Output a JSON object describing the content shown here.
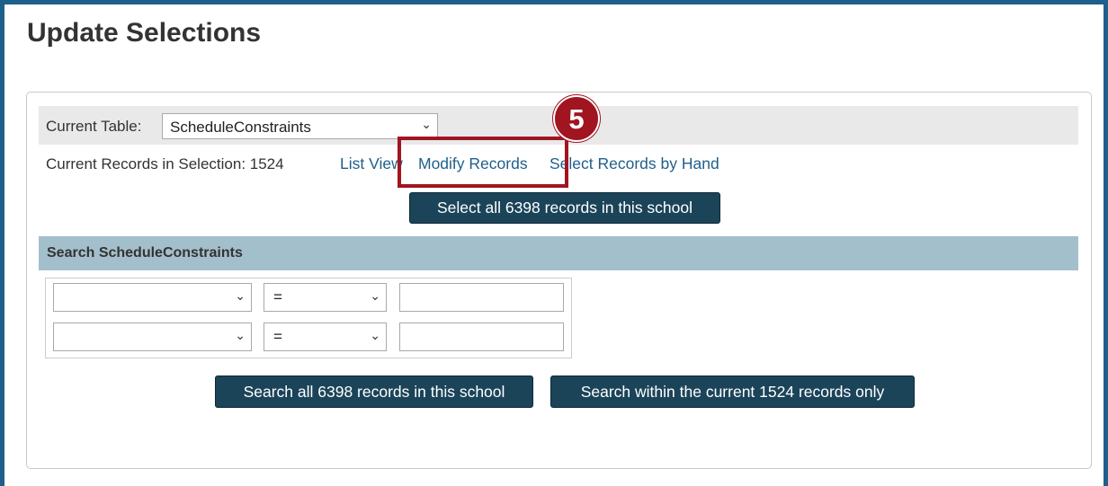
{
  "page": {
    "title": "Update Selections"
  },
  "table_bar": {
    "label": "Current Table:",
    "selected_table": "ScheduleConstraints"
  },
  "selection": {
    "records_label": "Current Records in Selection: 1524",
    "links": {
      "list_view": "List View",
      "modify_records": "Modify Records",
      "select_by_hand": "Select Records by Hand"
    },
    "select_all_button": "Select all 6398 records in this school"
  },
  "search": {
    "header": "Search ScheduleConstraints",
    "rows": [
      {
        "field": "",
        "operator": "=",
        "value": ""
      },
      {
        "field": "",
        "operator": "=",
        "value": ""
      }
    ],
    "search_all_button": "Search all 6398 records in this school",
    "search_within_button": "Search within the current 1524 records only"
  },
  "annotation": {
    "step_number": "5",
    "color": "#a01520"
  },
  "colors": {
    "frame": "#1f5f8b",
    "link": "#1f5f8b",
    "button": "#1b4459",
    "search_header": "#a3bfcb",
    "table_bar": "#e9e9e9"
  },
  "icons": {
    "dropdown": "chevron-down-icon"
  }
}
